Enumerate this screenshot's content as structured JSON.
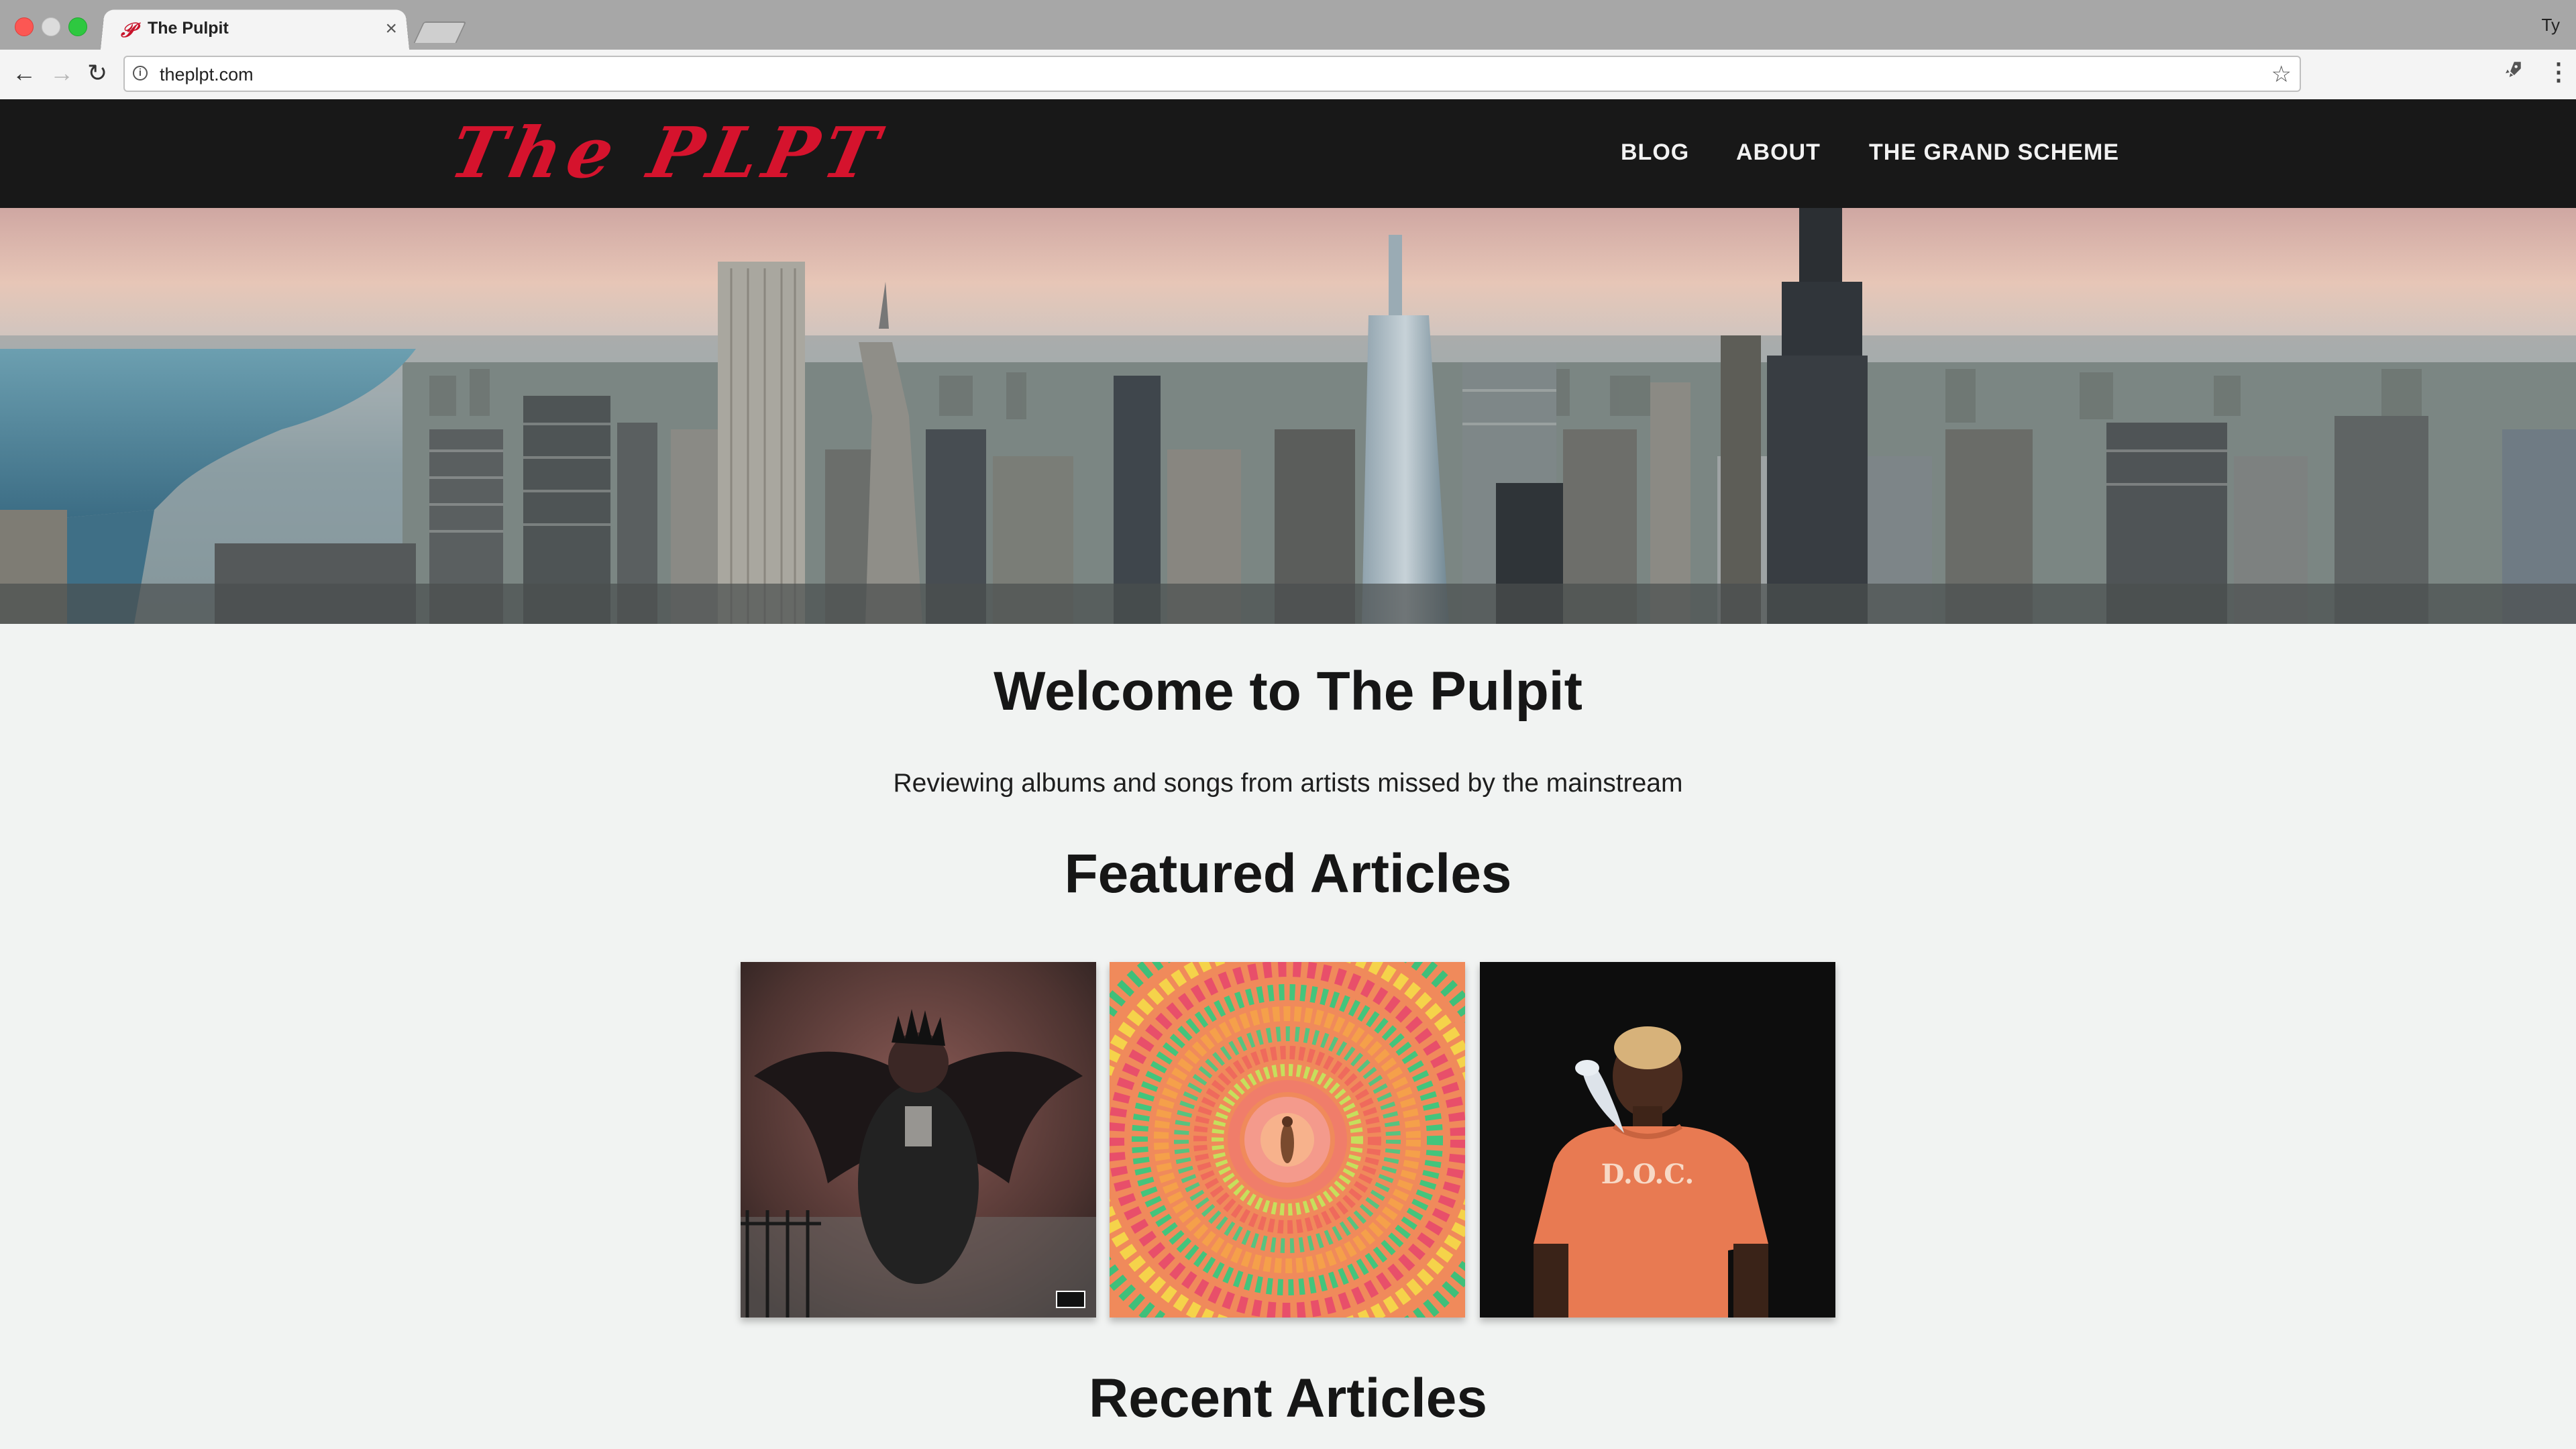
{
  "browser": {
    "tab_title": "The Pulpit",
    "tab_favicon": "𝒫",
    "profile_name": "Ty",
    "url": "theplpt.com",
    "icons": {
      "back": "back-arrow-icon",
      "forward": "forward-arrow-icon",
      "reload": "reload-icon",
      "info": "info-icon",
      "bookmark": "star-icon",
      "extension": "rocket-icon",
      "menu": "kebab-menu-icon"
    }
  },
  "site": {
    "logo_text": "The PLPT",
    "nav": {
      "blog": "BLOG",
      "about": "ABOUT",
      "grand_scheme": "THE GRAND SCHEME"
    },
    "colors": {
      "header_bg": "#181818",
      "logo_red": "#d5132d",
      "page_bg": "#f1f3f2"
    }
  },
  "main": {
    "welcome_heading": "Welcome to The Pulpit",
    "tagline": "Reviewing albums and songs from artists missed by the mainstream",
    "featured_heading": "Featured Articles",
    "recent_heading": "Recent Articles",
    "featured_albums": [
      {
        "name": "album-cover-dark-winged-figure"
      },
      {
        "name": "album-cover-psychedelic-mandala"
      },
      {
        "name": "album-cover-doc-orange-shirt",
        "shirt_text": "D.O.C."
      }
    ]
  }
}
